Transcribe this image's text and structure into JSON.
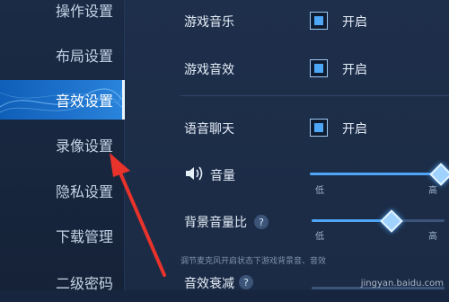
{
  "sidebar": {
    "items": [
      {
        "label": "操作设置"
      },
      {
        "label": "布局设置"
      },
      {
        "label": "音效设置"
      },
      {
        "label": "录像设置"
      },
      {
        "label": "隐私设置"
      },
      {
        "label": "下载管理"
      },
      {
        "label": "二级密码"
      }
    ],
    "active_index": 2
  },
  "settings": {
    "game_music": {
      "label": "游戏音乐",
      "check_label": "开启",
      "checked": true
    },
    "game_sfx": {
      "label": "游戏音效",
      "check_label": "开启",
      "checked": true
    },
    "voice_chat": {
      "label": "语音聊天",
      "check_label": "开启",
      "checked": true
    },
    "volume": {
      "label": "音量",
      "low": "低",
      "high": "高",
      "level": 1.0
    },
    "bg_volume_ratio": {
      "label": "背景音量比",
      "low": "低",
      "high": "高",
      "level": 0.6
    },
    "bg_hint": "调节麦克风开启状态下游戏背景音、音效",
    "sfx_decay": {
      "label": "音效衰减"
    }
  },
  "colors": {
    "accent": "#4ea6f7",
    "active_tab": "#1f73cc",
    "arrow": "#e8322c"
  },
  "watermark": "jingyan.baidu.com"
}
